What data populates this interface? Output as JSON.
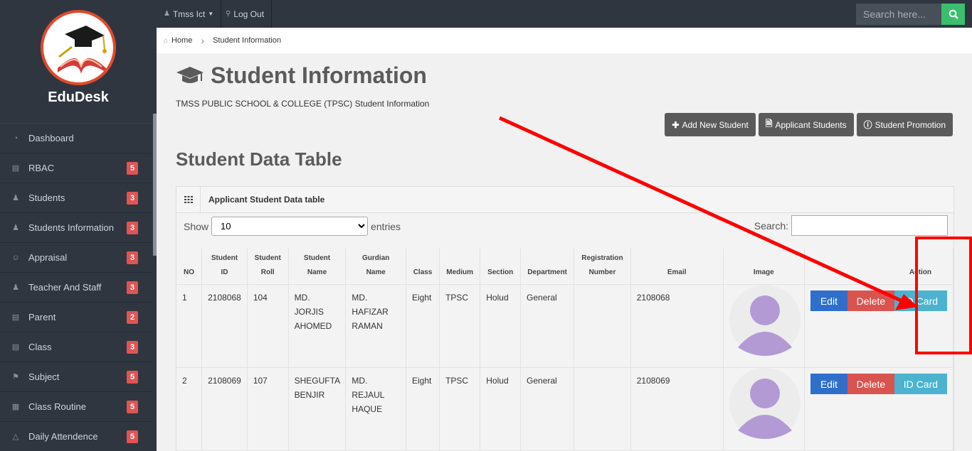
{
  "brand": {
    "name": "EduDesk"
  },
  "sidebar": {
    "items": [
      {
        "label": "Dashboard",
        "icon": "dashboard-icon",
        "badge": ""
      },
      {
        "label": "RBAC",
        "icon": "card-icon",
        "badge": "5"
      },
      {
        "label": "Students",
        "icon": "users-icon",
        "badge": "3"
      },
      {
        "label": "Students Information",
        "icon": "users-icon",
        "badge": "3"
      },
      {
        "label": "Appraisal",
        "icon": "smile-icon",
        "badge": "3"
      },
      {
        "label": "Teacher And Staff",
        "icon": "users-icon",
        "badge": "3"
      },
      {
        "label": "Parent",
        "icon": "document-icon",
        "badge": "2"
      },
      {
        "label": "Class",
        "icon": "id-card-icon",
        "badge": "3"
      },
      {
        "label": "Subject",
        "icon": "bookmark-icon",
        "badge": "5"
      },
      {
        "label": "Class Routine",
        "icon": "calendar-icon",
        "badge": "5"
      },
      {
        "label": "Daily Attendence",
        "icon": "area-chart-icon",
        "badge": "5"
      }
    ]
  },
  "topbar": {
    "user": "Tmss Ict",
    "logout": "Log Out",
    "search_placeholder": "Search here..."
  },
  "breadcrumb": {
    "home": "Home",
    "current": "Student Information"
  },
  "page": {
    "title": "Student Information",
    "subtitle": "TMSS PUBLIC SCHOOL & COLLEGE (TPSC) Student Information",
    "buttons": {
      "add": "Add New Student",
      "applicants": "Applicant Students",
      "promotion": "Student Promotion"
    },
    "section_title": "Student Data Table"
  },
  "panel": {
    "heading": "Applicant Student Data table",
    "show_label": "Show",
    "entries_value": "10",
    "entries_label": "entries",
    "search_label": "Search:"
  },
  "table": {
    "headers": {
      "no": "NO",
      "student_id": "Student ID",
      "student_roll": "Student Roll",
      "student_name": "Student Name",
      "gurdian_name": "Gurdian Name",
      "class": "Class",
      "medium": "Medium",
      "section": "Section",
      "department": "Department",
      "registration": "Registration Number",
      "email": "Email",
      "image": "Image",
      "action": "Action"
    },
    "rows": [
      {
        "no": "1",
        "id": "2108068",
        "roll": "104",
        "name": "MD. JORJIS AHOMED",
        "guardian": "MD. HAFIZAR RAMAN",
        "class": "Eight",
        "medium": "TPSC",
        "section": "Holud",
        "department": "General",
        "registration": "",
        "email": "2108068",
        "edit": "Edit",
        "delete": "Delete",
        "idcard": "ID Card"
      },
      {
        "no": "2",
        "id": "2108069",
        "roll": "107",
        "name": "SHEGUFTA BENJIR",
        "guardian": "MD. REJAUL HAQUE",
        "class": "Eight",
        "medium": "TPSC",
        "section": "Holud",
        "department": "General",
        "registration": "",
        "email": "2108069",
        "edit": "Edit",
        "delete": "Delete",
        "idcard": "ID Card"
      }
    ]
  },
  "colors": {
    "annotation": "#ff0000",
    "sidebar": "#2f3640",
    "accent_green": "#3bbf6e"
  }
}
